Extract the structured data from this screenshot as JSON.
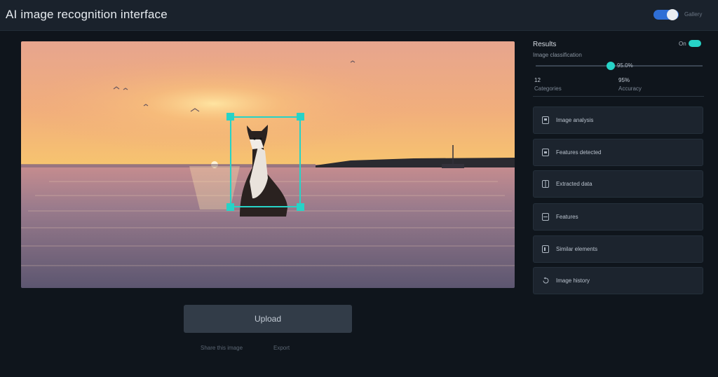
{
  "header": {
    "title": "AI image recognition interface",
    "toggle_label": "Gallery",
    "toggle_on": true
  },
  "stage": {
    "image_description": "sunset over sea with cat",
    "detection": {
      "label": "cat"
    }
  },
  "action": {
    "button_label": "Upload",
    "footnote_left": "Share this image",
    "footnote_right": "Export"
  },
  "panel": {
    "title": "Results",
    "subtitle": "Image classification",
    "switch_label": "On",
    "confidence_value": "95.0%",
    "confidence_level": 0.45,
    "stats": [
      {
        "value": "12",
        "label": "Categories"
      },
      {
        "value": "95%",
        "label": "Accuracy"
      }
    ],
    "items": [
      {
        "icon": "image-icon",
        "label": "Image analysis"
      },
      {
        "icon": "tag-icon",
        "label": "Features detected"
      },
      {
        "icon": "grid-icon",
        "label": "Extracted data"
      },
      {
        "icon": "box-icon",
        "label": "Features"
      },
      {
        "icon": "layers-icon",
        "label": "Similar elements"
      },
      {
        "icon": "history-icon",
        "label": "Image history"
      }
    ]
  },
  "colors": {
    "accent": "#27d3c7",
    "toggle": "#2f6fd6",
    "background": "#0f151c"
  }
}
